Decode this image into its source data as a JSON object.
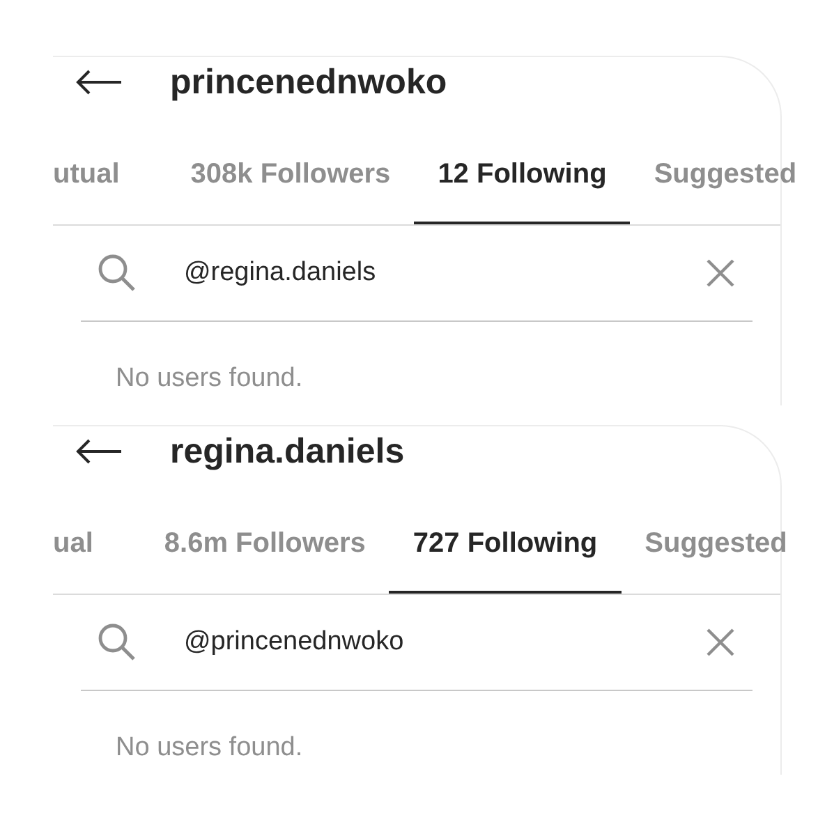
{
  "panels": [
    {
      "username": "princenednwoko",
      "tabs": [
        {
          "label": "utual",
          "selected": false
        },
        {
          "label": "308k Followers",
          "selected": false
        },
        {
          "label": "12 Following",
          "selected": true
        },
        {
          "label": "Suggested",
          "selected": false
        }
      ],
      "search": {
        "value": "@regina.daniels"
      },
      "empty_message": "No users found."
    },
    {
      "username": "regina.daniels",
      "tabs": [
        {
          "label": "ual",
          "selected": false
        },
        {
          "label": "8.6m Followers",
          "selected": false
        },
        {
          "label": "727 Following",
          "selected": true
        },
        {
          "label": "Suggested",
          "selected": false
        }
      ],
      "search": {
        "value": "@princenednwoko"
      },
      "empty_message": "No users found."
    }
  ]
}
